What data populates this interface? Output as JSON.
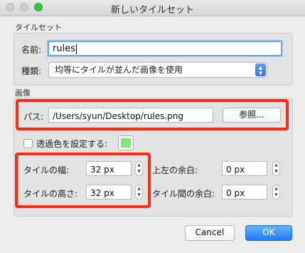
{
  "window": {
    "title": "新しいタイルセット"
  },
  "tileset": {
    "section_label": "タイルセット",
    "name_label": "名前:",
    "name_value": "rules",
    "type_label": "種類:",
    "type_value": "均等にタイルが並んだ画像を使用"
  },
  "image": {
    "section_label": "画像",
    "path_label": "パス:",
    "path_value": "/Users/syun/Desktop/rules.png",
    "browse_button": "参照...",
    "transparent_label": "透過色を設定する:",
    "transparent_checked": false,
    "transparent_color": "#86e57a"
  },
  "tiles": {
    "width_label": "タイルの幅:",
    "width_value": "32 px",
    "height_label": "タイルの高さ:",
    "height_value": "32 px",
    "margin_label": "上左の余白:",
    "margin_value": "0 px",
    "spacing_label": "タイル間の余白:",
    "spacing_value": "0 px"
  },
  "buttons": {
    "cancel": "Cancel",
    "ok": "OK"
  },
  "colors": {
    "highlight": "#ff2a14",
    "accent": "#1c7af5"
  }
}
